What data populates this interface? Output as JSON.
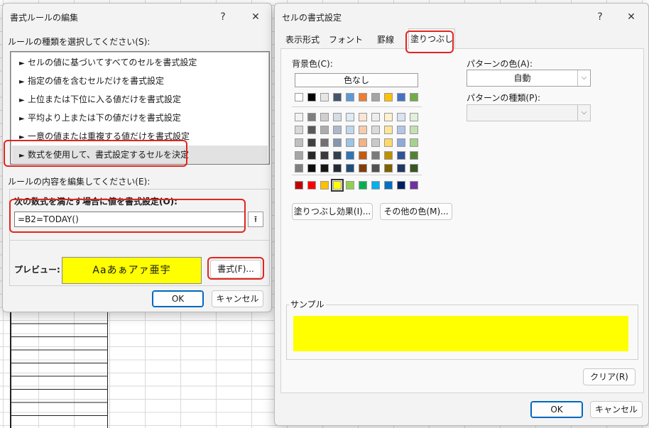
{
  "rule_dialog": {
    "title": "書式ルールの編集",
    "help": "?",
    "close": "✕",
    "rule_type_label": "ルールの種類を選択してください(S):",
    "rule_types": [
      {
        "label": "セルの値に基づいてすべてのセルを書式設定"
      },
      {
        "label": "指定の値を含むセルだけを書式設定"
      },
      {
        "label": "上位または下位に入る値だけを書式設定"
      },
      {
        "label": "平均より上または下の値だけを書式設定"
      },
      {
        "label": "一意の値または重複する値だけを書式設定"
      },
      {
        "label": "数式を使用して、書式設定するセルを決定"
      }
    ],
    "arrow": "►",
    "edit_label": "ルールの内容を編集してください(E):",
    "formula_label": "次の数式を満たす場合に値を書式設定(O):",
    "formula_value": "=B2=TODAY()",
    "ref_icon": "⭱",
    "preview_label": "プレビュー:",
    "preview_text": "Aaあぁアァ亜宇",
    "format_button": "書式(F)...",
    "ok": "OK",
    "cancel": "キャンセル"
  },
  "format_dialog": {
    "title": "セルの書式設定",
    "help": "?",
    "close": "✕",
    "tabs": [
      {
        "label": "表示形式"
      },
      {
        "label": "フォント"
      },
      {
        "label": "罫線"
      },
      {
        "label": "塗りつぶし"
      }
    ],
    "active_tab": "塗りつぶし",
    "bg_color_label": "背景色(C):",
    "no_color": "色なし",
    "palette": {
      "top": [
        "#ffffff",
        "#000000",
        "#e7e6e6",
        "#44546a",
        "#5b9bd5",
        "#ed7d31",
        "#a5a5a5",
        "#ffc000",
        "#4472c4",
        "#70ad47"
      ],
      "shades": [
        [
          "#f2f2f2",
          "#7f7f7f",
          "#d0cece",
          "#d6dce4",
          "#deebf6",
          "#fbe5d5",
          "#ededed",
          "#fff2cc",
          "#dae3f3",
          "#e2efd9"
        ],
        [
          "#d8d8d8",
          "#595959",
          "#aeabab",
          "#adb9ca",
          "#bdd7ee",
          "#f7cbac",
          "#dbdbdb",
          "#fee599",
          "#b4c6e7",
          "#c5e0b3"
        ],
        [
          "#bfbfbf",
          "#3f3f3f",
          "#757070",
          "#8496b0",
          "#9dc3e6",
          "#f4b183",
          "#c9c9c9",
          "#ffd965",
          "#8eaadb",
          "#a8d08d"
        ],
        [
          "#a5a5a5",
          "#262626",
          "#3a3838",
          "#323f4f",
          "#2e75b5",
          "#c55a11",
          "#7b7b7b",
          "#bf9000",
          "#2f5496",
          "#538135"
        ],
        [
          "#7f7f7f",
          "#0c0c0c",
          "#171616",
          "#222a35",
          "#1f4e79",
          "#833c0b",
          "#525252",
          "#7f6000",
          "#1f3864",
          "#375623"
        ]
      ],
      "standard": [
        "#c00000",
        "#ff0000",
        "#ffc000",
        "#ffff00",
        "#92d050",
        "#00b050",
        "#00b0f0",
        "#0070c0",
        "#002060",
        "#7030a0"
      ],
      "selected_standard_index": 3
    },
    "fill_effects": "塗りつぶし効果(I)...",
    "more_colors": "その他の色(M)...",
    "pattern_color_label": "パターンの色(A):",
    "pattern_color_value": "自動",
    "pattern_type_label": "パターンの種類(P):",
    "pattern_type_value": "",
    "dropdown_icon": "⌵",
    "sample_label": "サンプル",
    "sample_color": "#ffff00",
    "clear": "クリア(R)",
    "ok": "OK",
    "cancel": "キャンセル"
  }
}
